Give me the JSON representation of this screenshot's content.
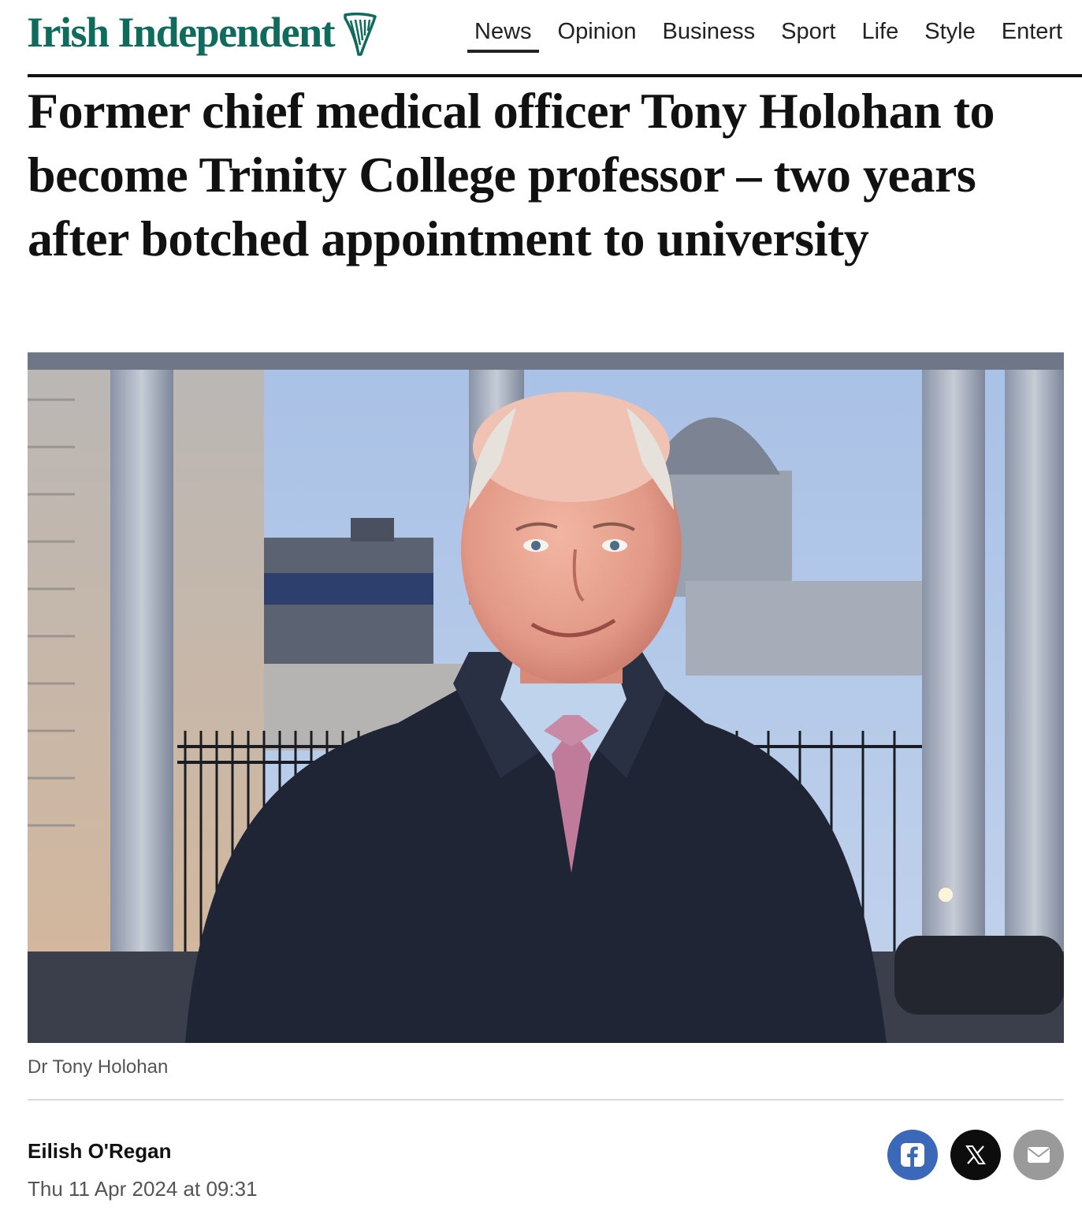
{
  "masthead": {
    "logo_text": "Irish Independent",
    "logo_icon": "harp-icon",
    "brand_color": "#0f6b5c"
  },
  "nav": {
    "items": [
      {
        "label": "News",
        "active": true
      },
      {
        "label": "Opinion",
        "active": false
      },
      {
        "label": "Business",
        "active": false
      },
      {
        "label": "Sport",
        "active": false
      },
      {
        "label": "Life",
        "active": false
      },
      {
        "label": "Style",
        "active": false
      },
      {
        "label": "Entert",
        "active": false
      }
    ]
  },
  "article": {
    "headline": "Former chief medical officer Tony Holohan to become Trinity College professor – two years after botched appointment to university",
    "image_caption": "Dr Tony Holohan",
    "author": "Eilish O'Regan",
    "published": "Thu 11 Apr 2024 at 09:31"
  },
  "share": {
    "facebook_icon": "facebook-icon",
    "x_icon": "x-icon",
    "email_icon": "email-icon",
    "colors": {
      "facebook": "#3b68b8",
      "x": "#0d0d0d",
      "email": "#9a9a9a"
    }
  }
}
